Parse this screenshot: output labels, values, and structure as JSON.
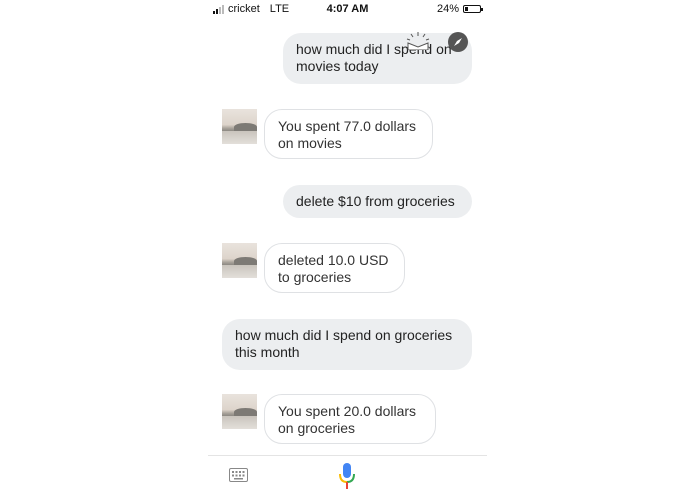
{
  "status_bar": {
    "carrier": "cricket",
    "network": "LTE",
    "time": "4:07 AM",
    "battery": "24%",
    "battery_level": 0.24
  },
  "messages": [
    {
      "role": "user",
      "text": "how much did I spend on movies today"
    },
    {
      "role": "assistant",
      "text": "You spent 77.0 dollars on movies"
    },
    {
      "role": "user",
      "text": "delete $10 from groceries"
    },
    {
      "role": "assistant",
      "text": "deleted 10.0 USD to groceries"
    },
    {
      "role": "user",
      "text": "how much did I spend on groceries this month"
    },
    {
      "role": "assistant",
      "text": "You spent 20.0 dollars on groceries"
    }
  ],
  "icons": {
    "explore": "compass-icon",
    "keyboard": "keyboard-icon",
    "mic": "mic-icon",
    "assistant": "assistant-avatar"
  },
  "colors": {
    "user_bubble": "#eceef0",
    "bot_border": "#dfe1e4",
    "mic_blue": "#4285f4",
    "mic_red": "#ea4335",
    "mic_yellow": "#fbbc05",
    "mic_green": "#34a853"
  }
}
